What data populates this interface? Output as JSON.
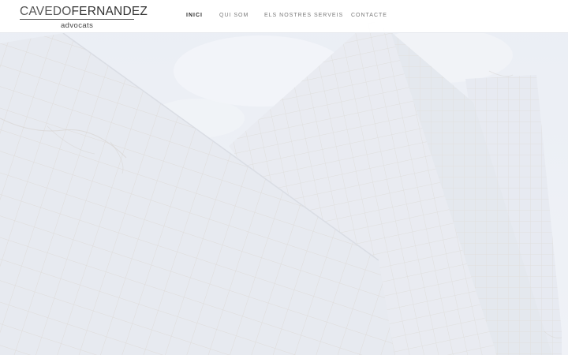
{
  "brand": {
    "name_first": "CAVEDO",
    "name_second": "FERNANDEZ",
    "tagline": "advocats"
  },
  "nav": {
    "items": [
      {
        "label": "INICI",
        "active": true
      },
      {
        "label": "QUI SOM",
        "active": false
      },
      {
        "label": "ELS NOSTRES SERVEIS",
        "active": false
      },
      {
        "label": "CONTACTE",
        "active": false
      }
    ]
  },
  "hero": {
    "image": "glass-office-building-facade",
    "overlay_color": "#eef1f6"
  }
}
